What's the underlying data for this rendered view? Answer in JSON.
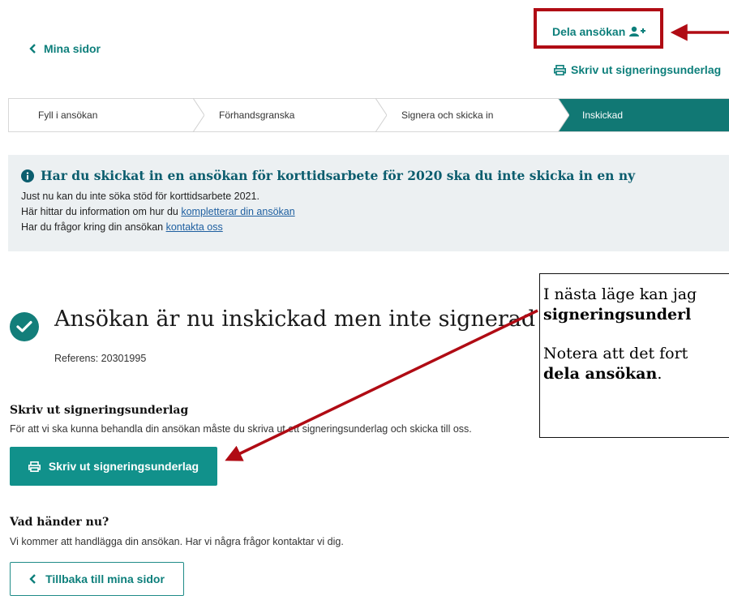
{
  "nav": {
    "back_label": "Mina sidor",
    "share_label": "Dela ansökan",
    "print_label": "Skriv ut signeringsunderlag"
  },
  "steps": [
    {
      "label": "Fyll i ansökan"
    },
    {
      "label": "Förhandsgranska"
    },
    {
      "label": "Signera och skicka in"
    },
    {
      "label": "Inskickad",
      "active": true
    }
  ],
  "info": {
    "title": "Har du skickat in en ansökan för korttidsarbete för 2020 ska du inte skicka in en ny",
    "line1": "Just nu kan du inte söka stöd för korttidsarbete 2021.",
    "line2_prefix": "Här hittar du information om hur du ",
    "line2_link": "kompletterar din ansökan",
    "line3_prefix": "Har du frågor kring din ansökan ",
    "line3_link": "kontakta oss"
  },
  "confirmation": {
    "heading": "Ansökan är nu inskickad men inte signerad",
    "reference": "Referens: 20301995"
  },
  "print_section": {
    "title": "Skriv ut signeringsunderlag",
    "text": "För att vi ska kunna behandla din ansökan måste du skriva ut ett signeringsunderlag och skicka till oss.",
    "button_label": "Skriv ut signeringsunderlag"
  },
  "next_section": {
    "title": "Vad händer nu?",
    "text": "Vi kommer att handlägga din ansökan. Har vi några frågor kontaktar vi dig.",
    "back_button_label": "Tillbaka till mina sidor"
  },
  "annotation": {
    "line1": "I nästa läge kan jag",
    "line2_bold": "signeringsunderl",
    "line3": "Notera att det fort",
    "line4_bold": "dela ansökan",
    "line4_tail": "."
  },
  "colors": {
    "accent": "#0d7f7b",
    "step_active": "#117874",
    "annotation_red": "#b00b14"
  },
  "icons": [
    "chevron-left-icon",
    "user-plus-icon",
    "printer-icon",
    "info-circle-icon",
    "check-circle-icon"
  ]
}
